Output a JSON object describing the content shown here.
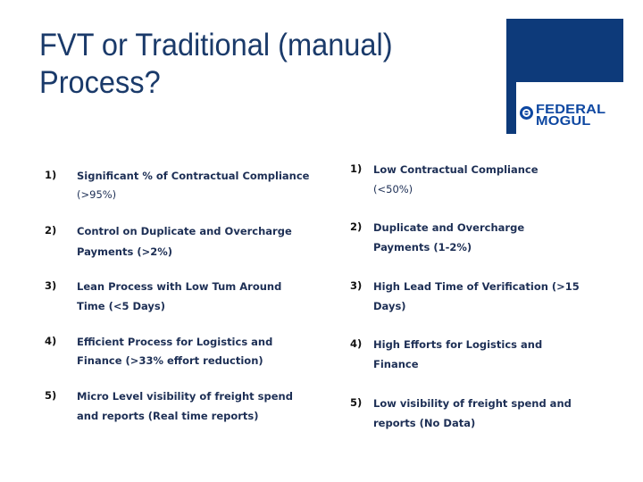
{
  "slide": {
    "title_line1": "FVT or Traditional (manual)",
    "title_line2": "Process?"
  },
  "logo": {
    "brand_line1": "FEDERAL",
    "brand_line2": "MOGUL",
    "brand_color": "#0d47a1",
    "block_color": "#0d3a7a"
  },
  "left_column": {
    "items": [
      {
        "number": "1)",
        "line1": "Significant % of Contractual Compliance",
        "line2": "(>95%)"
      },
      {
        "number": "2)",
        "line1": " Control on Duplicate and Overcharge",
        "line2": "Payments (>2%)"
      },
      {
        "number": "3)",
        "line1": " Lean Process with Low Tum Around",
        "line2": "Time (<5 Days)"
      },
      {
        "number": "4)",
        "line1": " Efficient Process for Logistics and",
        "line2": "Finance  (>33% effort reduction)"
      },
      {
        "number": "5)",
        "line1": " Micro Level visibility of freight spend",
        "line2": "and reports (Real time reports)"
      }
    ]
  },
  "right_column": {
    "items": [
      {
        "number": "1)",
        "line1": "Low  Contractual Compliance",
        "line2": "(<50%)"
      },
      {
        "number": "2)",
        "line1": " Duplicate and Overcharge",
        "line2": "Payments (1-2%)"
      },
      {
        "number": "3)",
        "line1": " High Lead Time of Verification (>15",
        "line2": "Days)"
      },
      {
        "number": "4)",
        "line1": " High Efforts for Logistics and",
        "line2": "Finance"
      },
      {
        "number": "5)",
        "line1": " Low visibility of freight spend and",
        "line2": "reports (No Data)"
      }
    ]
  }
}
